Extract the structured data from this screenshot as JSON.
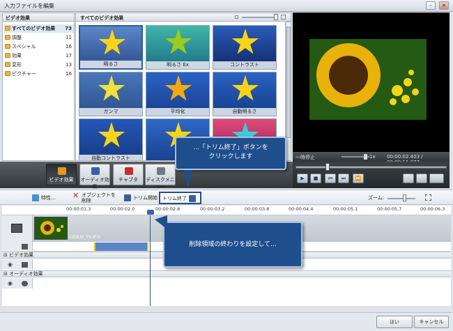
{
  "window": {
    "title": "入力ファイルを編集",
    "min_glyph": "–",
    "close_glyph": "×"
  },
  "effects_panel": {
    "header": "ビデオ効果",
    "categories": [
      {
        "label": "すべてのビデオ効果",
        "count": "73"
      },
      {
        "label": "調整",
        "count": "11"
      },
      {
        "label": "スペシャル",
        "count": "16"
      },
      {
        "label": "効果",
        "count": "17"
      },
      {
        "label": "変形",
        "count": "13"
      },
      {
        "label": "ピクチャー",
        "count": "16"
      }
    ]
  },
  "grid": {
    "header": "すべてのビデオ効果",
    "tiles": [
      "明るさ",
      "明るさ Ex",
      "コントラスト",
      "ガンマ",
      "平均化",
      "自動明るさ",
      "自動コントラスト",
      "",
      ""
    ]
  },
  "player": {
    "state": "一時停止",
    "speed": "1x",
    "time": "00:00:02.403 / 00:00:11.077",
    "buttons": [
      "▶",
      "■",
      "⏮",
      "⏭",
      "⏩"
    ]
  },
  "tabs": [
    "ビデオ効果",
    "オーディオ効果",
    "チャプタ",
    "ディスクメニュー"
  ],
  "toolbar": {
    "properties": "特性...",
    "delete_object": "オブジェクトを削除",
    "trim_start": "トリム開始",
    "trim_end": "トリム終了",
    "zoom_label": "ズーム:"
  },
  "ruler": [
    "00:00:01.3",
    "00:00:02.0",
    "00:00:02.6",
    "00:00:03.2",
    "00:00:03.8",
    "00:00:04.4",
    "00:00:05.1",
    "00:00:05.7",
    "00:00:06.3"
  ],
  "timeline": {
    "clip_name": "VIDEO_TS.IFO",
    "group_video": "ビデオ効果",
    "group_audio": "オーディオ効果"
  },
  "callouts": {
    "top": "...「トリム終了」ボタンを\nクリックします",
    "bottom": "削除領域の終わりを設定して..."
  },
  "footer": {
    "ok": "はい",
    "cancel": "キャンセル"
  },
  "colors": {
    "accent": "#1f4e8c",
    "star": "#f7d417",
    "selection": "#5b86c6"
  }
}
